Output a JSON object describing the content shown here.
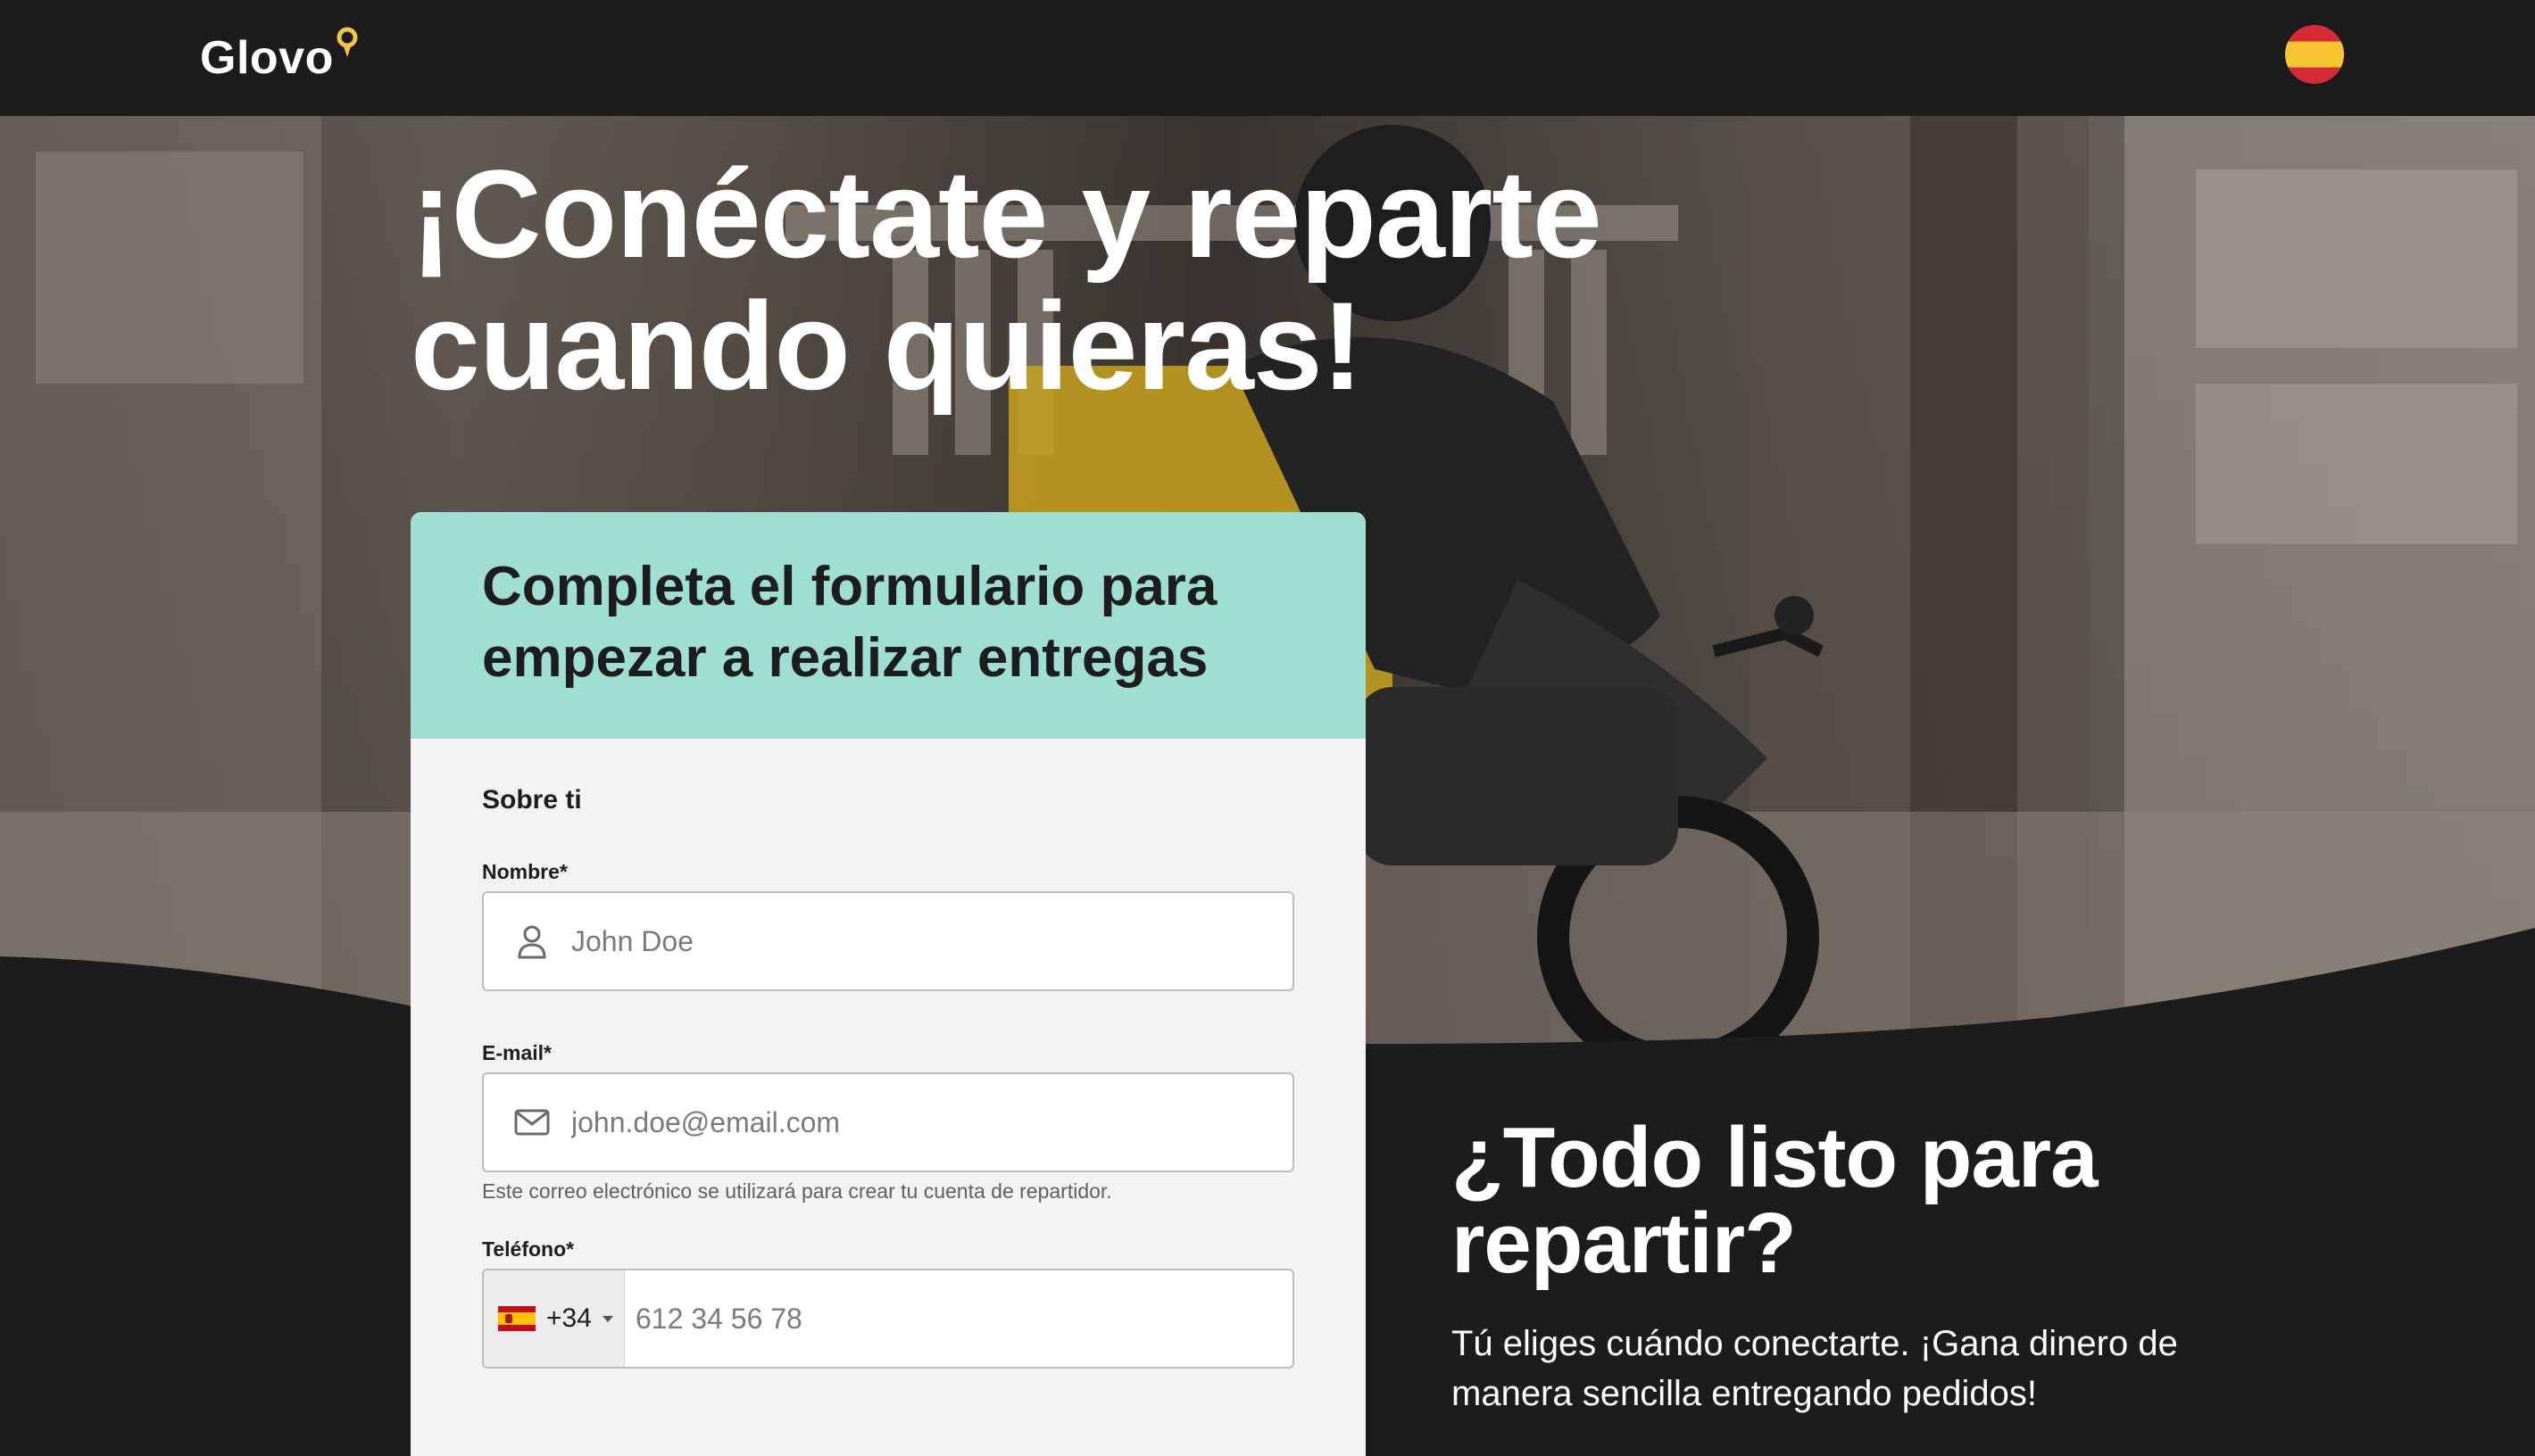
{
  "header": {
    "logo_text": "Glovo",
    "language_flag": "spain-flag",
    "colors": {
      "bar": "#1c1c1c",
      "logo_pin": "#f6c343"
    }
  },
  "hero": {
    "title": "¡Conéctate y reparte cuando quieras!"
  },
  "form": {
    "heading": "Completa el formulario para empezar a realizar entregas",
    "section_title": "Sobre ti",
    "name": {
      "label": "Nombre*",
      "placeholder": "John Doe",
      "icon": "user-icon"
    },
    "email": {
      "label": "E-mail*",
      "placeholder": "john.doe@email.com",
      "icon": "envelope-icon",
      "help": "Este correo electrónico se utilizará para crear tu cuenta de repartidor."
    },
    "phone": {
      "label": "Teléfono*",
      "dial_code": "+34",
      "country_flag": "spain-flag",
      "placeholder": "612 34 56 78"
    },
    "colors": {
      "header_bg": "#9fdfd1",
      "body_bg": "#f3f3f3"
    }
  },
  "ready": {
    "title": "¿Todo listo para repartir?",
    "text": "Tú eliges cuándo conectarte. ¡Gana dinero de manera sencilla entregando pedidos!"
  }
}
